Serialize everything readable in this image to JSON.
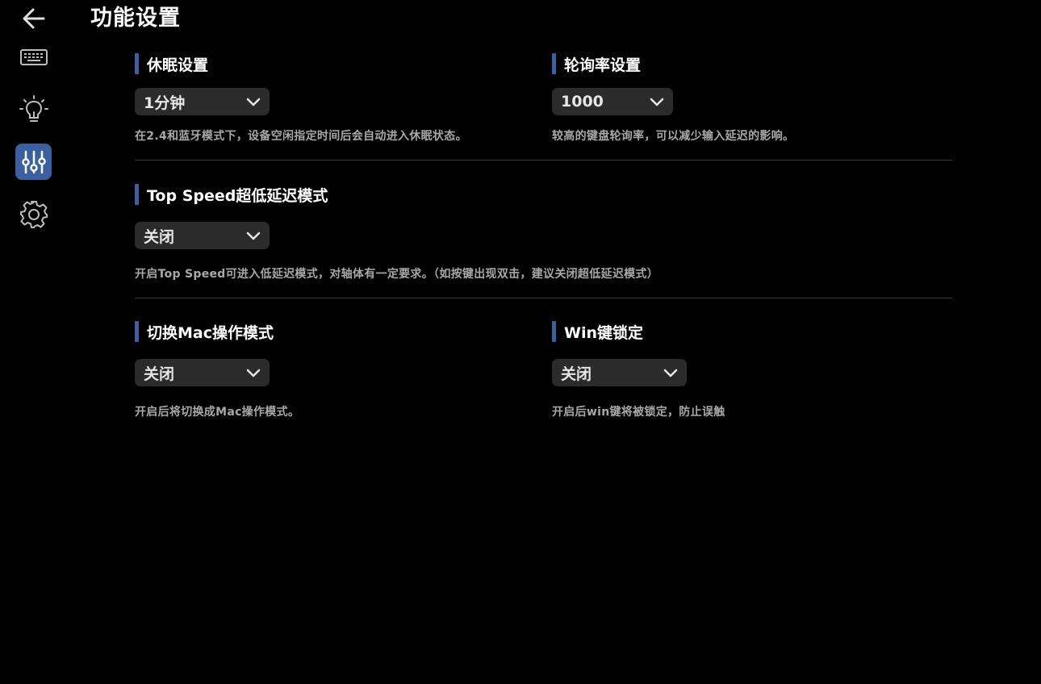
{
  "page": {
    "title": "功能设置"
  },
  "sidebar": {
    "back_icon": "arrow-left-icon",
    "items": [
      {
        "icon": "keyboard-icon",
        "active": false
      },
      {
        "icon": "lightbulb-icon",
        "active": false
      },
      {
        "icon": "sliders-icon",
        "active": true
      },
      {
        "icon": "gear-icon",
        "active": false
      }
    ]
  },
  "sections": {
    "sleep": {
      "title": "休眠设置",
      "value": "1分钟",
      "description": "在2.4和蓝牙模式下，设备空闲指定时间后会自动进入休眠状态。"
    },
    "polling": {
      "title": "轮询率设置",
      "value": "1000",
      "description": "较高的键盘轮询率，可以减少输入延迟的影响。"
    },
    "top_speed": {
      "title": "Top Speed超低延迟模式",
      "value": "关闭",
      "description": "开启Top Speed可进入低延迟模式，对轴体有一定要求。（如按键出现双击，建议关闭超低延迟模式）"
    },
    "mac_mode": {
      "title": "切换Mac操作模式",
      "value": "关闭",
      "description": "开启后将切换成Mac操作模式。"
    },
    "win_lock": {
      "title": "Win键锁定",
      "value": "关闭",
      "description": "开启后win键将被锁定，防止误触"
    }
  },
  "colors": {
    "background": "#000000",
    "accent": "#3a5fa3",
    "dropdown_bg": "#2b2b2b",
    "description_text": "#a8a8a8",
    "divider": "#3c3c3c"
  }
}
